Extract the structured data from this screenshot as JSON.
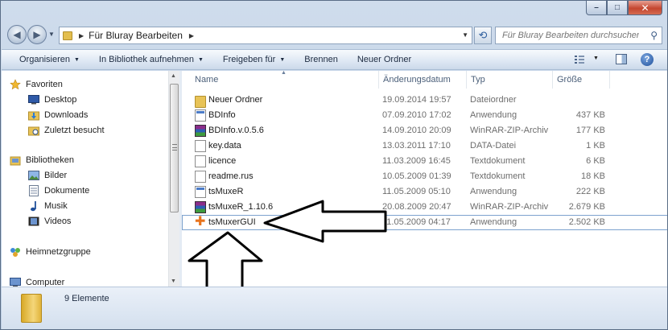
{
  "window": {
    "caption": {
      "minimize": "–",
      "maximize": "□",
      "close": "✕"
    }
  },
  "address": {
    "path": "Für Bluray Bearbeiten",
    "search_placeholder": "Für Bluray Bearbeiten durchsuchen"
  },
  "toolbar": {
    "organize": "Organisieren",
    "include_library": "In Bibliothek aufnehmen",
    "share": "Freigeben für",
    "burn": "Brennen",
    "new_folder": "Neuer Ordner"
  },
  "navpane": {
    "favorites": "Favoriten",
    "desktop": "Desktop",
    "downloads": "Downloads",
    "recent": "Zuletzt besucht",
    "libraries": "Bibliotheken",
    "pictures": "Bilder",
    "documents": "Dokumente",
    "music": "Musik",
    "videos": "Videos",
    "homegroup": "Heimnetzgruppe",
    "computer": "Computer"
  },
  "columns": {
    "name": "Name",
    "date": "Änderungsdatum",
    "type": "Typ",
    "size": "Größe"
  },
  "files": [
    {
      "name": "Neuer Ordner",
      "date": "19.09.2014 19:57",
      "type": "Dateiordner",
      "size": "",
      "icon": "folder-icon"
    },
    {
      "name": "BDInfo",
      "date": "07.09.2010 17:02",
      "type": "Anwendung",
      "size": "437 KB",
      "icon": "application-icon"
    },
    {
      "name": "BDInfo.v.0.5.6",
      "date": "14.09.2010 20:09",
      "type": "WinRAR-ZIP-Archiv",
      "size": "177 KB",
      "icon": "winrar-icon"
    },
    {
      "name": "key.data",
      "date": "13.03.2011 17:10",
      "type": "DATA-Datei",
      "size": "1 KB",
      "icon": "document-icon"
    },
    {
      "name": "licence",
      "date": "11.03.2009 16:45",
      "type": "Textdokument",
      "size": "6 KB",
      "icon": "document-icon"
    },
    {
      "name": "readme.rus",
      "date": "10.05.2009 01:39",
      "type": "Textdokument",
      "size": "18 KB",
      "icon": "document-icon"
    },
    {
      "name": "tsMuxeR",
      "date": "11.05.2009 05:10",
      "type": "Anwendung",
      "size": "222 KB",
      "icon": "application-icon"
    },
    {
      "name": "tsMuxeR_1.10.6",
      "date": "20.08.2009 20:47",
      "type": "WinRAR-ZIP-Archiv",
      "size": "2.679 KB",
      "icon": "winrar-icon"
    },
    {
      "name": "tsMuxerGUI",
      "date": "11.05.2009 04:17",
      "type": "Anwendung",
      "size": "2.502 KB",
      "icon": "tsmuxergui-icon"
    }
  ],
  "status": {
    "count": "9 Elemente"
  },
  "colors": {
    "accent": "#3d6fb4",
    "chrome": "#c4d4e8"
  }
}
